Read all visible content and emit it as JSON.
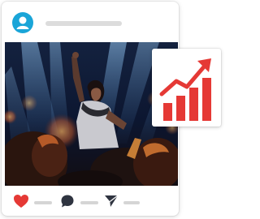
{
  "post": {
    "avatar_icon": "user-avatar-icon",
    "actions": [
      {
        "name": "like-button",
        "icon": "heart-icon",
        "color": "#e53935"
      },
      {
        "name": "comment-button",
        "icon": "comment-bubble-icon",
        "color": "#2f3440"
      },
      {
        "name": "share-button",
        "icon": "send-arrow-icon",
        "color": "#2f3440"
      }
    ]
  },
  "growth_badge": {
    "icon": "bar-chart-growth-icon",
    "color": "#e53935"
  },
  "colors": {
    "accent": "#1aa5d8",
    "like": "#e53935",
    "growth": "#e53935"
  }
}
